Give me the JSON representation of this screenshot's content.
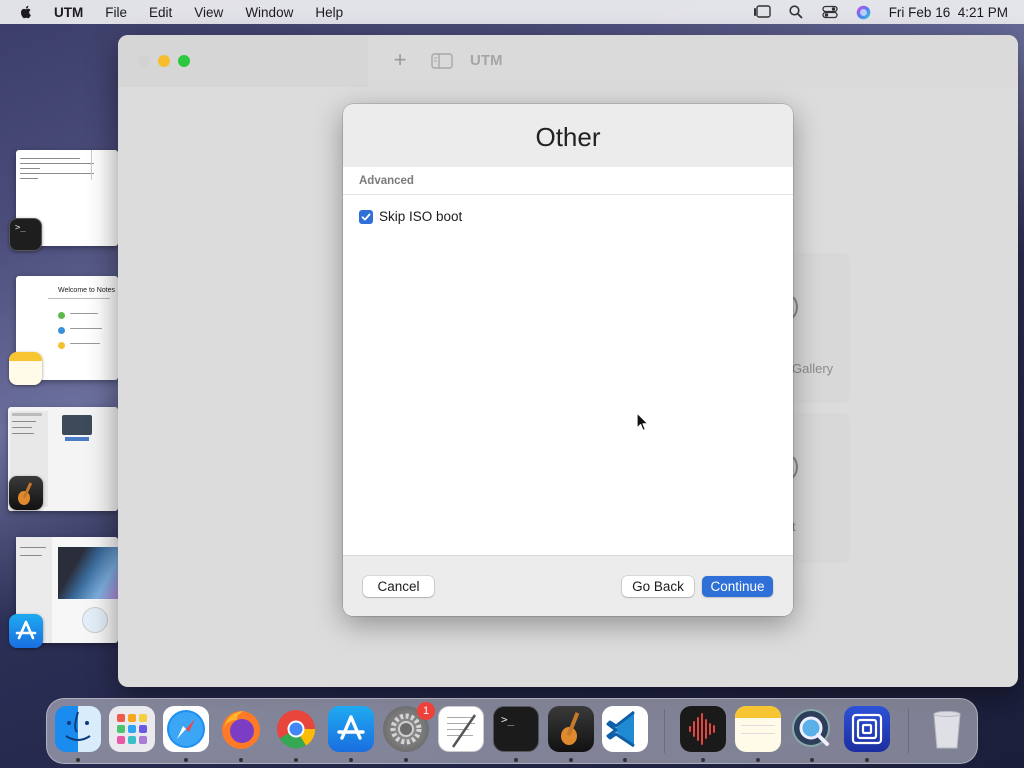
{
  "menubar": {
    "app": "UTM",
    "items": [
      "File",
      "Edit",
      "View",
      "Window",
      "Help"
    ],
    "clock": "Fri Feb 16  4:21 PM"
  },
  "stage_manager": {
    "windows": [
      {
        "app": "Terminal",
        "icon": "terminal-icon"
      },
      {
        "app": "Notes",
        "icon": "notes-icon",
        "thumb_title": "Welcome to Notes"
      },
      {
        "app": "GarageBand",
        "icon": "garageband-icon"
      },
      {
        "app": "App Store",
        "icon": "app-store-icon"
      }
    ]
  },
  "utm_window": {
    "title": "UTM",
    "background_partial_text": {
      "gallery": "Gallery",
      "fragment": "t"
    }
  },
  "dialog": {
    "title": "Other",
    "section_header": "Advanced",
    "checkbox": {
      "label": "Skip ISO boot",
      "checked": true
    },
    "buttons": {
      "cancel": "Cancel",
      "back": "Go Back",
      "continue": "Continue"
    }
  },
  "dock": {
    "apps": [
      {
        "name": "Finder",
        "icon": "finder-icon",
        "running": true
      },
      {
        "name": "Launchpad",
        "icon": "launchpad-icon",
        "running": false
      },
      {
        "name": "Safari",
        "icon": "safari-icon",
        "running": true
      },
      {
        "name": "Firefox",
        "icon": "firefox-icon",
        "running": true
      },
      {
        "name": "Chrome",
        "icon": "chrome-icon",
        "running": true
      },
      {
        "name": "App Store",
        "icon": "app-store-icon",
        "running": true
      },
      {
        "name": "System Settings",
        "icon": "settings-icon",
        "running": true,
        "badge": "1"
      },
      {
        "name": "TextEdit",
        "icon": "textedit-icon",
        "running": false
      },
      {
        "name": "Terminal",
        "icon": "terminal-icon",
        "running": true
      },
      {
        "name": "GarageBand",
        "icon": "garageband-icon",
        "running": true
      },
      {
        "name": "VS Code",
        "icon": "vscode-icon",
        "running": true
      },
      {
        "name": "Voice Memos",
        "icon": "voice-memos-icon",
        "running": true
      },
      {
        "name": "Notes",
        "icon": "notes-icon",
        "running": true
      },
      {
        "name": "QuickTime Player",
        "icon": "quicktime-icon",
        "running": true
      },
      {
        "name": "UTM",
        "icon": "utm-icon",
        "running": true
      },
      {
        "name": "Trash",
        "icon": "trash-icon",
        "running": false
      }
    ]
  },
  "colors": {
    "accent": "#2f6fd8",
    "badge": "#f0403a"
  }
}
